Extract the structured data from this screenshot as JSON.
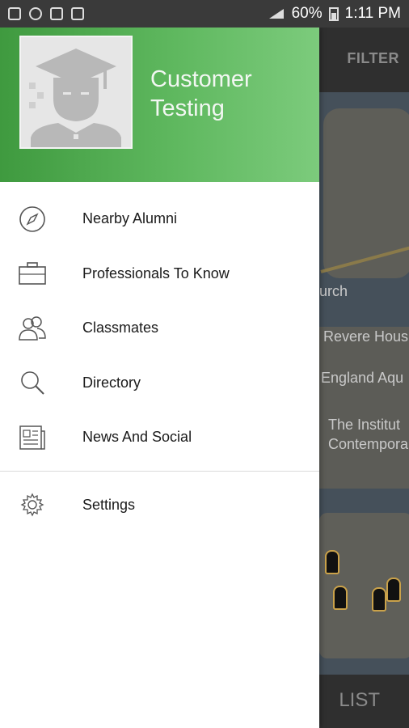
{
  "status_bar": {
    "battery": "60%",
    "time": "1:11 PM"
  },
  "app": {
    "filter_label": "FILTER",
    "list_label": "LIST",
    "map_labels": [
      "urch",
      "Revere Hous",
      "England Aqu",
      "The Institut",
      "Contempora"
    ]
  },
  "drawer": {
    "profile_name": "Customer Testing",
    "menu": [
      {
        "label": "Nearby Alumni",
        "icon": "compass-icon"
      },
      {
        "label": "Professionals To Know",
        "icon": "briefcase-icon"
      },
      {
        "label": "Classmates",
        "icon": "people-icon"
      },
      {
        "label": "Directory",
        "icon": "search-icon"
      },
      {
        "label": "News And Social",
        "icon": "newspaper-icon"
      }
    ],
    "settings": {
      "label": "Settings",
      "icon": "gear-icon"
    }
  },
  "colors": {
    "header_green": "#4caf50",
    "drawer_bg": "#ffffff"
  }
}
